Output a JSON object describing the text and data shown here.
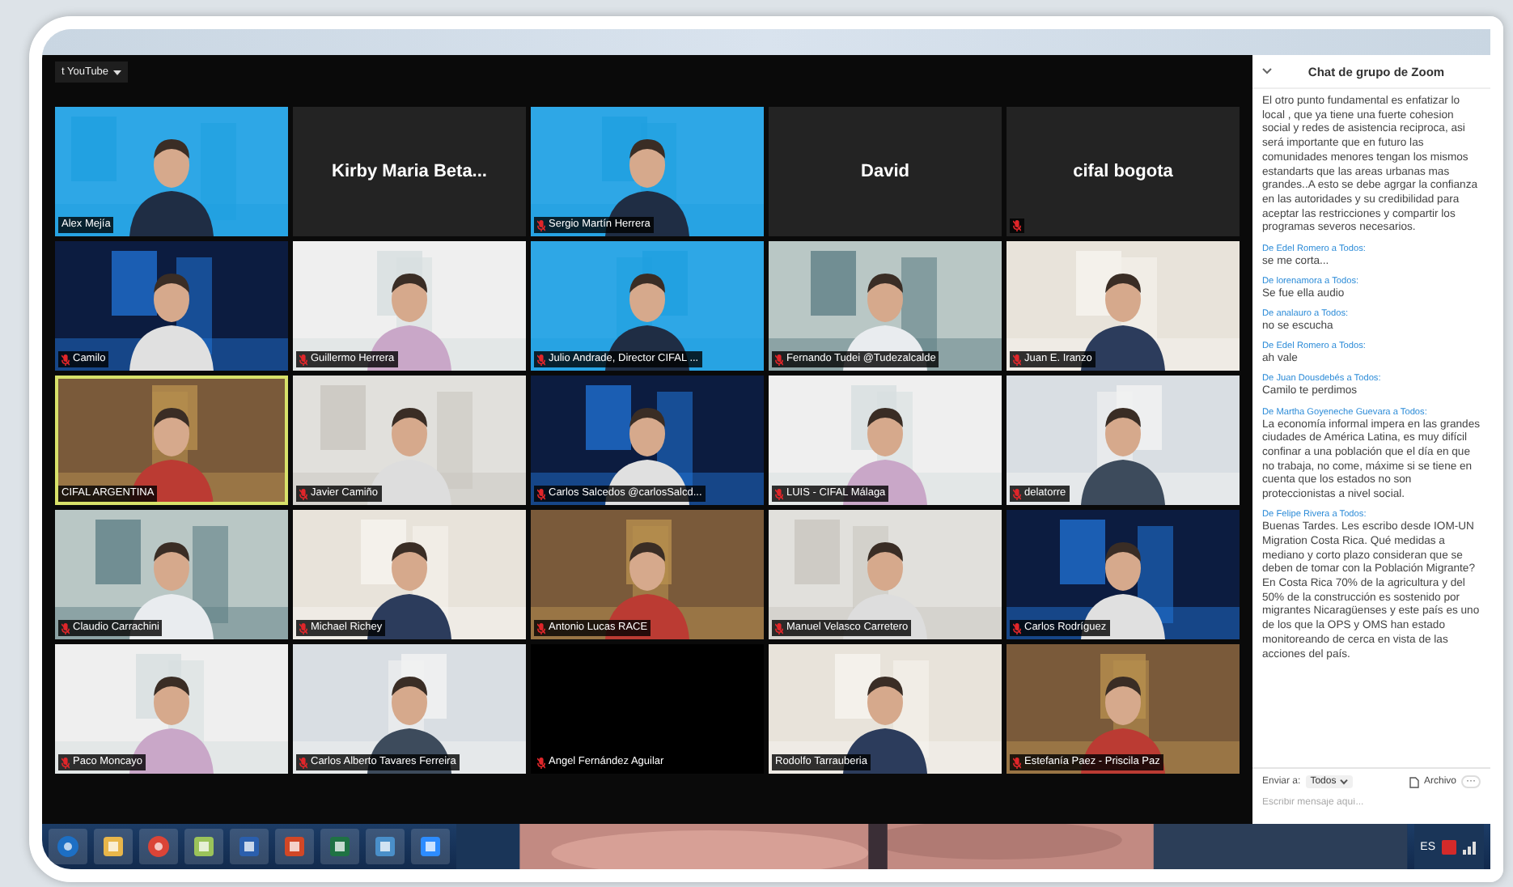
{
  "meeting": {
    "view_button": {
      "label": "t YouTube"
    },
    "participants": [
      {
        "name": "Alex Mejía",
        "kind": "video",
        "muted": false,
        "speaking": false
      },
      {
        "name": "Kirby Maria Beta...",
        "kind": "name",
        "muted": false,
        "speaking": false
      },
      {
        "name": "Sergio Martín Herrera",
        "kind": "video",
        "muted": true,
        "speaking": false
      },
      {
        "name": "David",
        "kind": "name",
        "muted": false,
        "speaking": false
      },
      {
        "name": "cifal bogota",
        "kind": "name",
        "muted": true,
        "speaking": false
      },
      {
        "name": "Camilo",
        "kind": "video",
        "muted": true,
        "speaking": false
      },
      {
        "name": "Guillermo Herrera",
        "kind": "video",
        "muted": true,
        "speaking": false
      },
      {
        "name": "Julio Andrade, Director CIFAL ...",
        "kind": "video",
        "muted": true,
        "speaking": false
      },
      {
        "name": "Fernando Tudei @Tudezalcalde",
        "kind": "video",
        "muted": true,
        "speaking": false
      },
      {
        "name": "Juan E. Iranzo",
        "kind": "video",
        "muted": true,
        "speaking": false
      },
      {
        "name": "CIFAL ARGENTINA",
        "kind": "video",
        "muted": false,
        "speaking": true
      },
      {
        "name": "Javier Camiño",
        "kind": "video",
        "muted": true,
        "speaking": false
      },
      {
        "name": "Carlos Salcedos @carlosSalcd...",
        "kind": "video",
        "muted": true,
        "speaking": false
      },
      {
        "name": "LUIS - CIFAL Málaga",
        "kind": "video",
        "muted": true,
        "speaking": false
      },
      {
        "name": "delatorre",
        "kind": "video",
        "muted": true,
        "speaking": false
      },
      {
        "name": "Claudio Carrachini",
        "kind": "video",
        "muted": true,
        "speaking": false
      },
      {
        "name": "Michael Richey",
        "kind": "video",
        "muted": true,
        "speaking": false
      },
      {
        "name": "Antonio Lucas RACE",
        "kind": "video",
        "muted": true,
        "speaking": false
      },
      {
        "name": "Manuel Velasco Carretero",
        "kind": "video",
        "muted": true,
        "speaking": false
      },
      {
        "name": "Carlos Rodríguez",
        "kind": "video",
        "muted": true,
        "speaking": false
      },
      {
        "name": "Paco Moncayo",
        "kind": "video",
        "muted": true,
        "speaking": false
      },
      {
        "name": "Carlos Alberto Tavares Ferreira",
        "kind": "video",
        "muted": true,
        "speaking": false
      },
      {
        "name": "Angel Fernández Aguilar",
        "kind": "blank",
        "muted": true,
        "speaking": false
      },
      {
        "name": "Rodolfo Tarrauberia",
        "kind": "video",
        "muted": false,
        "speaking": false
      },
      {
        "name": "Estefanía Paez - Priscila Paz",
        "kind": "video",
        "muted": true,
        "speaking": false
      }
    ]
  },
  "chat": {
    "title": "Chat de grupo de Zoom",
    "messages": [
      {
        "text": "El otro punto fundamental es enfatizar lo local , que ya tiene una fuerte cohesion social y redes de asistencia reciproca, asi será importante que en futuro las comunidades menores tengan los mismos estandarts que las areas urbanas mas grandes..A esto se debe agrgar la confianza en las autoridades y su credibilidad para aceptar las restricciones y compartir los programas severos necesarios."
      },
      {
        "header": "De Edel Romero a Todos:",
        "text": "se me corta..."
      },
      {
        "header": "De lorenamora a Todos:",
        "text": "Se fue ella audio"
      },
      {
        "header": "De analauro a Todos:",
        "text": "no se escucha"
      },
      {
        "header": "De Edel Romero a Todos:",
        "text": "ah vale"
      },
      {
        "header": "De Juan Dousdebés a Todos:",
        "text": "Camilo te perdimos"
      },
      {
        "header": "De Martha Goyeneche Guevara a Todos:",
        "text": "La economía informal impera en las grandes ciudades de América Latina, es muy difícil confinar a una población que el día en que no trabaja, no come, máxime si se tiene en cuenta que los estados no son proteccionistas a nivel social."
      },
      {
        "header": "De Felipe Rivera a Todos:",
        "text": "Buenas Tardes. Les escribo desde IOM-UN Migration Costa Rica. Qué medidas a mediano y corto plazo consideran que se deben de tomar con la Población Migrante?  En Costa Rica  70% de la agricultura y del 50% de la construcción es sostenido por migrantes Nicaragüenses y este país es uno de los que la OPS y OMS han estado monitoreando de cerca en vista de las acciones del país."
      }
    ],
    "send_to_label": "Enviar a:",
    "recipient": "Todos",
    "file_button": "Archivo",
    "more_button": "···",
    "input": {
      "placeholder": "Escribir mensaje aquí..."
    }
  },
  "taskbar": {
    "language": "ES"
  }
}
